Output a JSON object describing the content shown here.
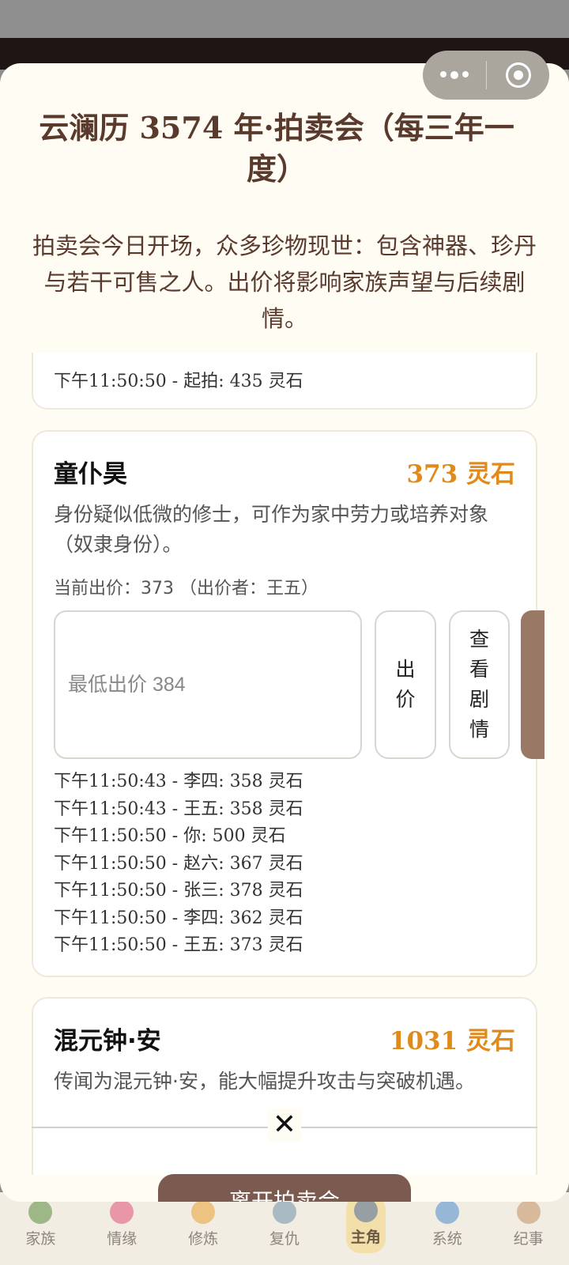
{
  "modal": {
    "title": "云澜历 3574 年·拍卖会（每三年一度）",
    "description": "拍卖会今日开场，众多珍物现世：包含神器、珍丹与若干可售之人。出价将影响家族声望与后续剧情。",
    "confirm_label": "离开拍卖会"
  },
  "prev_item": {
    "log_last": "下午11:50:50 - 起拍: 435 灵石"
  },
  "item1": {
    "name": "童仆昊",
    "price": "373 灵石",
    "description": "身份疑似低微的修士，可作为家中劳力或培养对象（奴隶身份）。",
    "current_bid": "当前出价：373 （出价者：王五）",
    "input_placeholder": "最低出价 384",
    "bid_label": "出价",
    "story_label": "查看剧情",
    "logs": [
      "下午11:50:43 - 李四: 358 灵石",
      "下午11:50:43 - 王五: 358 灵石",
      "下午11:50:50 - 你: 500 灵石",
      "下午11:50:50 - 赵六: 367 灵石",
      "下午11:50:50 - 张三: 378 灵石",
      "下午11:50:50 - 李四: 362 灵石",
      "下午11:50:50 - 王五: 373 灵石"
    ]
  },
  "item2": {
    "name": "混元钟·安",
    "price": "1031 灵石",
    "description": "传闻为混元钟·安，能大幅提升攻击与突破机遇。"
  },
  "tabs": [
    {
      "label": "家族",
      "icon": "tree-icon",
      "color": "#5a8a3a"
    },
    {
      "label": "情缘",
      "icon": "heart-icon",
      "color": "#e0507a"
    },
    {
      "label": "修炼",
      "icon": "meditate-icon",
      "color": "#e8a030"
    },
    {
      "label": "复仇",
      "icon": "swords-icon",
      "color": "#6f8fa8"
    },
    {
      "label": "主角",
      "icon": "hero-icon",
      "color": "#4a6aa0"
    },
    {
      "label": "系统",
      "icon": "gear-icon",
      "color": "#4a8ad0"
    },
    {
      "label": "纪事",
      "icon": "scroll-icon",
      "color": "#c09060"
    }
  ],
  "active_tab": "主角"
}
